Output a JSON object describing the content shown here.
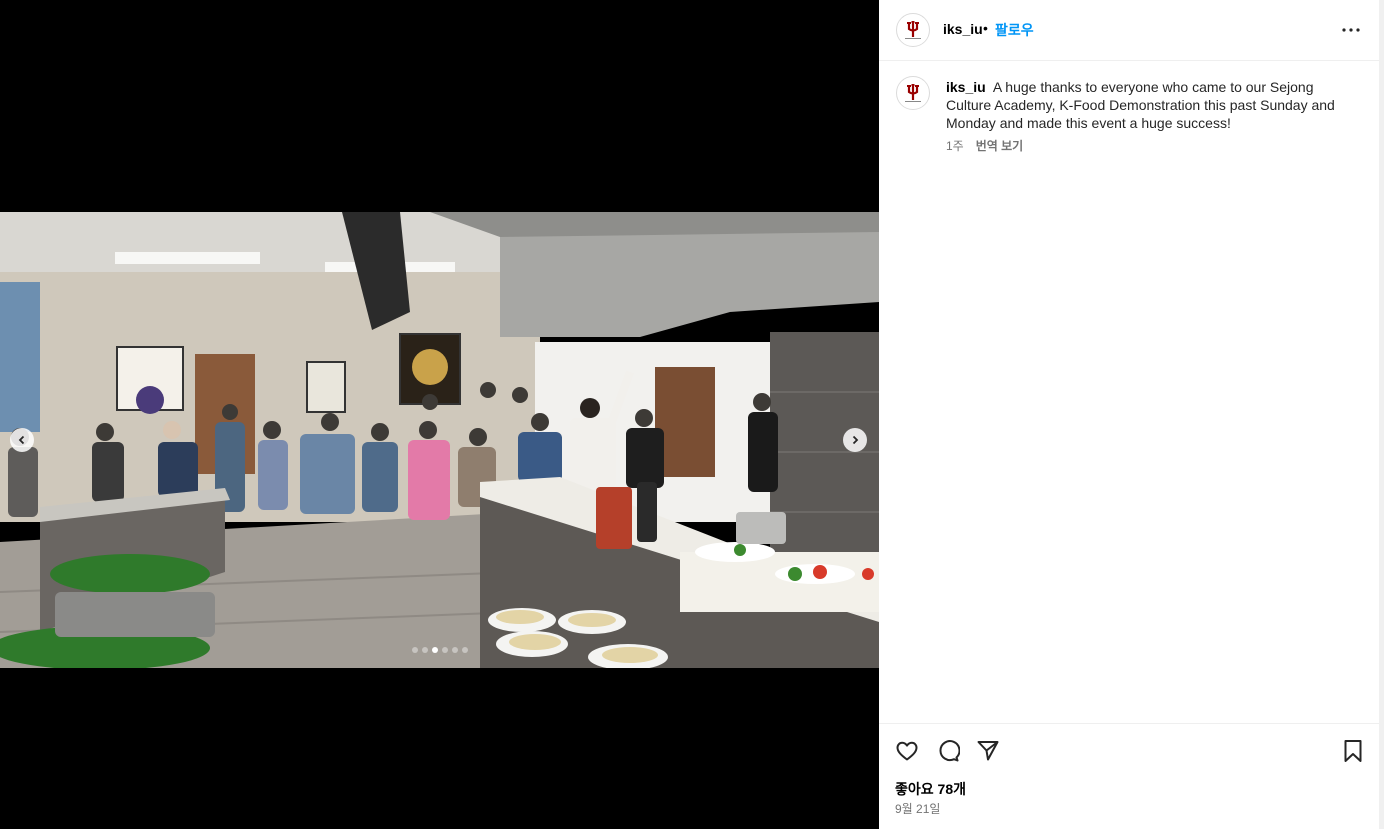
{
  "post": {
    "username": "iks_iu",
    "separator": "•",
    "follow_label": "팔로우",
    "caption": "A huge thanks to everyone who came to our Sejong Culture Academy, K-Food Demonstration this past Sunday and Monday and made this event a huge success!",
    "caption_age": "1주",
    "translate_label": "번역 보기",
    "likes": "좋아요 78개",
    "date": "9월 21일"
  },
  "carousel": {
    "slide_count": 6,
    "active_index": 2
  },
  "icons": {
    "more": "more-horizontal-icon",
    "prev": "chevron-left-icon",
    "next": "chevron-right-icon",
    "like": "heart-icon",
    "comment": "comment-icon",
    "share": "paper-plane-icon",
    "save": "bookmark-icon"
  },
  "colors": {
    "accent": "#0095f6",
    "brand_crimson": "#990000",
    "muted_text": "#737373"
  }
}
